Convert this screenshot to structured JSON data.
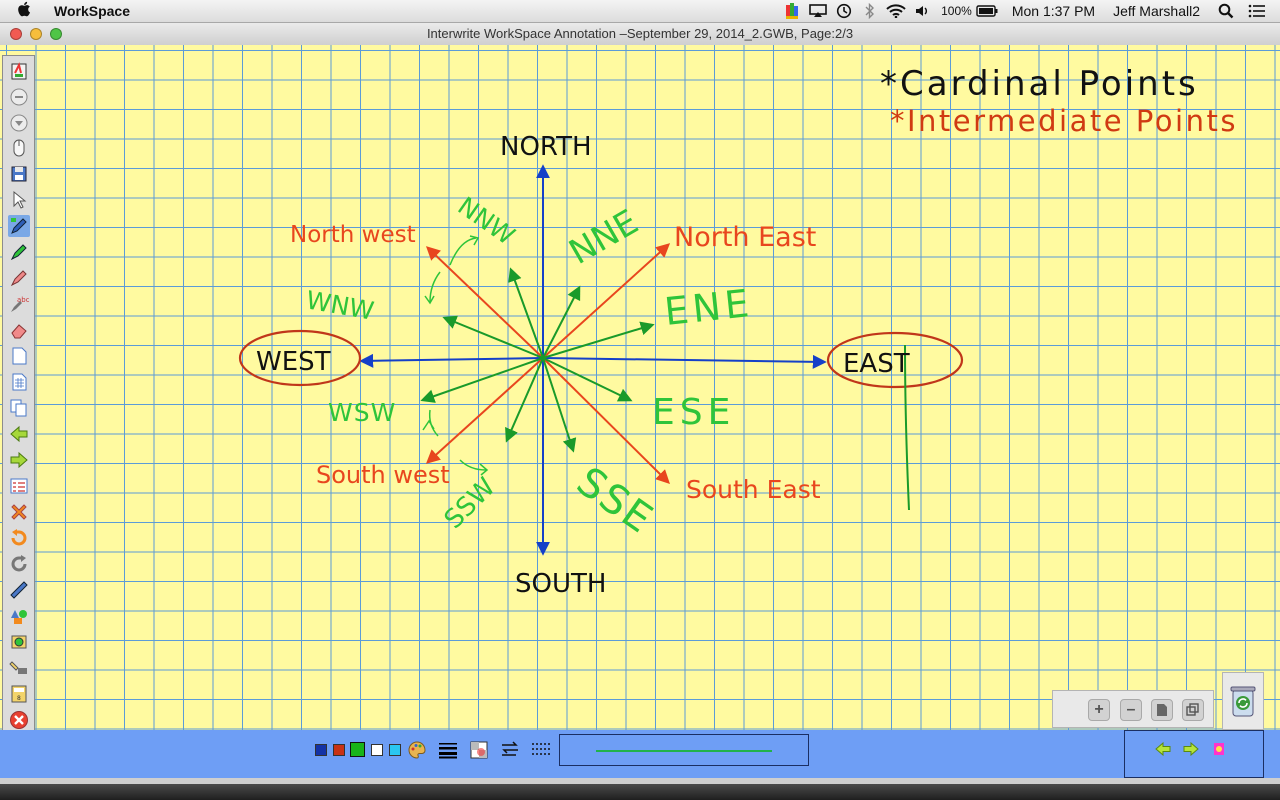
{
  "menubar": {
    "app_name": "WorkSpace",
    "battery": "100%",
    "clock": "Mon 1:37 PM",
    "user": "Jeff Marshall2"
  },
  "window": {
    "title": "Interwrite WorkSpace Annotation –September 29, 2014_2.GWB, Page:2/3"
  },
  "canvas": {
    "heading_cardinal": "*Cardinal Points",
    "heading_intermediate": "*Intermediate Points",
    "labels": {
      "north": "NORTH",
      "south": "SOUTH",
      "east": "EAST",
      "west": "WEST",
      "north_east": "North East",
      "north_west": "North west",
      "south_east": "South East",
      "south_west": "South west",
      "nne": "NNE",
      "nnw": "NNW",
      "ene": "ENE",
      "ese": "ESE",
      "wnw": "WNW",
      "wsw": "WSW",
      "ssw": "SSW",
      "sse": "SSE"
    },
    "colors": {
      "paper": "#fffaa0",
      "grid": "#5b9bd8",
      "cardinal": "#1540c8",
      "intermediate": "#e8461e",
      "secondary": "#1a9a2a",
      "secondary_label": "#2fc43a",
      "ink": "#111111",
      "heading_red": "#d03a12"
    }
  },
  "bottombar": {
    "swatches": [
      "#1433a6",
      "#c83214",
      "#18b418",
      "#ffffff",
      "#29c6f0"
    ]
  },
  "icons": {
    "menubar": [
      "apple-icon",
      "color-picker-icon",
      "airplay-icon",
      "time-machine-icon",
      "bluetooth-icon",
      "wifi-icon",
      "volume-icon",
      "battery-icon",
      "spotlight-icon",
      "notification-center-icon"
    ],
    "toolbar": [
      "workspace-logo-icon",
      "circle-button-icon",
      "down-circle-icon",
      "mouse-icon",
      "save-icon",
      "select-arrow-icon",
      "pen-icon",
      "highlighter-icon",
      "marker-icon",
      "text-recognition-icon",
      "eraser-icon",
      "blank-page-icon",
      "grid-page-icon",
      "copy-page-icon",
      "previous-page-icon",
      "next-page-icon",
      "page-sorter-icon",
      "delete-icon",
      "undo-icon",
      "redo-icon",
      "ruler-icon",
      "shapes-icon",
      "screen-capture-icon",
      "spotlight-tool-icon",
      "calculator-icon",
      "close-icon",
      "tools-icon"
    ],
    "zoom": [
      "zoom-in-icon",
      "zoom-out-icon",
      "page-icon",
      "duplicate-icon"
    ]
  }
}
